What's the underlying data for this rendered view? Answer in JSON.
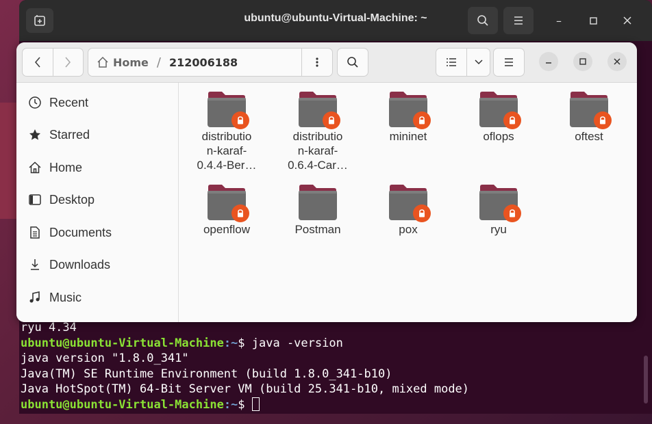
{
  "terminal": {
    "title": "ubuntu@ubuntu-Virtual-Machine: ~",
    "lines": {
      "l1": "ryu 4.34",
      "l2_user": "ubuntu@ubuntu-Virtual-Machine",
      "l2_path": ":~",
      "l2_cmd": "$ java -version",
      "l3": "java version \"1.8.0_341\"",
      "l4": "Java(TM) SE Runtime Environment (build 1.8.0_341-b10)",
      "l5": "Java HotSpot(TM) 64-Bit Server VM (build 25.341-b10, mixed mode)",
      "l6_user": "ubuntu@ubuntu-Virtual-Machine",
      "l6_path": ":~",
      "l6_cmd": "$ "
    }
  },
  "files": {
    "path": {
      "home": "Home",
      "separator": "/",
      "current": "212006188"
    },
    "sidebar": [
      {
        "label": "Recent",
        "icon": "clock-icon"
      },
      {
        "label": "Starred",
        "icon": "star-icon"
      },
      {
        "label": "Home",
        "icon": "home-icon"
      },
      {
        "label": "Desktop",
        "icon": "desktop-icon"
      },
      {
        "label": "Documents",
        "icon": "document-icon"
      },
      {
        "label": "Downloads",
        "icon": "download-icon"
      },
      {
        "label": "Music",
        "icon": "music-icon"
      }
    ],
    "items": [
      {
        "label": "distributio n-karaf- 0.4.4-Ber…",
        "locked": true
      },
      {
        "label": "distributio n-karaf- 0.6.4-Car…",
        "locked": true
      },
      {
        "label": "mininet",
        "locked": true
      },
      {
        "label": "oflops",
        "locked": true
      },
      {
        "label": "oftest",
        "locked": true
      },
      {
        "label": "openflow",
        "locked": true
      },
      {
        "label": "Postman",
        "locked": false
      },
      {
        "label": "pox",
        "locked": true
      },
      {
        "label": "ryu",
        "locked": true
      }
    ]
  },
  "colors": {
    "accent": "#e95420",
    "folder": "#6b6b6b",
    "folder_tab": "#8a2f48",
    "terminal_bg": "#300a24",
    "prompt_user": "#8ae234",
    "prompt_path": "#729fcf"
  }
}
